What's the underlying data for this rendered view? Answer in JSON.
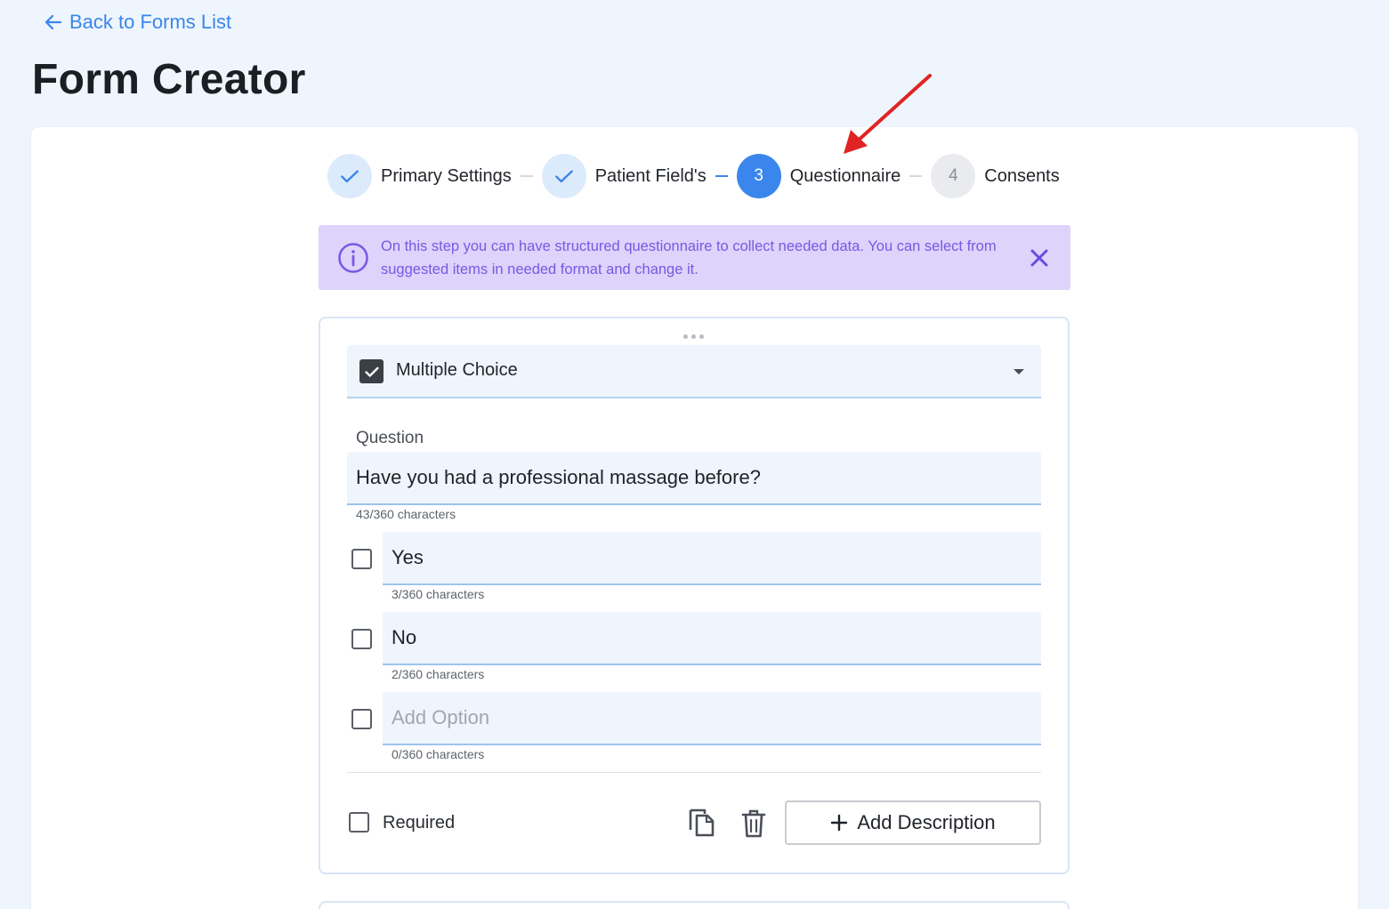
{
  "nav": {
    "back_label": "Back to Forms List"
  },
  "page": {
    "title": "Form Creator"
  },
  "stepper": {
    "steps": [
      {
        "number": "",
        "label": "Primary Settings",
        "state": "done"
      },
      {
        "number": "",
        "label": "Patient Field's",
        "state": "done"
      },
      {
        "number": "3",
        "label": "Questionnaire",
        "state": "active"
      },
      {
        "number": "4",
        "label": "Consents",
        "state": "todo"
      }
    ]
  },
  "info_banner": {
    "text": "On this step you can have structured questionnaire to collect needed data. You can select from suggested items in needed format and change it."
  },
  "question": {
    "type_label": "Multiple Choice",
    "question_label": "Question",
    "question_value": "Have you had a professional massage before?",
    "question_counter": "43/360 characters",
    "options": [
      {
        "value": "Yes",
        "placeholder": "",
        "counter": "3/360 characters"
      },
      {
        "value": "No",
        "placeholder": "",
        "counter": "2/360 characters"
      },
      {
        "value": "",
        "placeholder": "Add Option",
        "counter": "0/360 characters"
      }
    ],
    "required_label": "Required",
    "add_description_label": "Add Description"
  },
  "colors": {
    "accent": "#3b86ec",
    "banner_bg": "#ddd3fb",
    "banner_text": "#7b57e3",
    "annotation_arrow": "#e02424"
  },
  "icons": {
    "back": "arrow-left-icon",
    "done": "check-icon",
    "info": "info-circle-icon",
    "close": "close-icon",
    "type": "checkbox-checked-icon",
    "caret": "caret-down-icon",
    "duplicate": "copy-icon",
    "delete": "trash-icon",
    "add": "plus-icon"
  }
}
